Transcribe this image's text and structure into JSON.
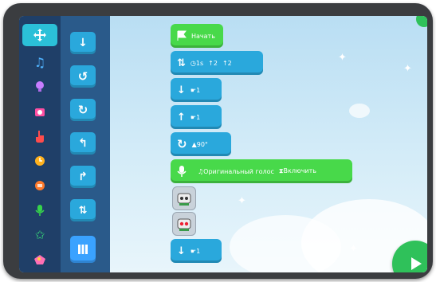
{
  "colors": {
    "category_bg": "#1f3f68",
    "palette_bg": "#2a5a8a",
    "block_blue": "#2aa8dc",
    "block_green": "#48d94a",
    "active_category": "#2bc0d8",
    "play_button": "#2fc15a"
  },
  "categories": [
    {
      "icon": "move-arrows-icon"
    },
    {
      "icon": "music-note-icon"
    },
    {
      "icon": "lightbulb-icon"
    },
    {
      "icon": "camera-icon"
    },
    {
      "icon": "hand-pointer-icon"
    },
    {
      "icon": "clock-icon"
    },
    {
      "icon": "sync-icon"
    },
    {
      "icon": "microphone-icon"
    },
    {
      "icon": "star-icon"
    },
    {
      "icon": "palette-icon"
    }
  ],
  "palette": [
    {
      "icon": "arrow-down-icon"
    },
    {
      "icon": "rotate-left-icon"
    },
    {
      "icon": "rotate-right-icon"
    },
    {
      "icon": "turn-left-icon"
    },
    {
      "icon": "turn-right-icon"
    },
    {
      "icon": "move-vertical-icon"
    },
    {
      "icon": "pause-bars-icon"
    }
  ],
  "script": {
    "start_label": "Начать",
    "move_block": {
      "time": "1s",
      "up": "2",
      "right": "2"
    },
    "down_block": {
      "value": "1"
    },
    "up_block": {
      "value": "1"
    },
    "rotate_block": {
      "value": "90°"
    },
    "voice_block": {
      "voice": "Оригинальный голос",
      "toggle": "Включить"
    },
    "last_down_block": {
      "value": "1"
    }
  }
}
